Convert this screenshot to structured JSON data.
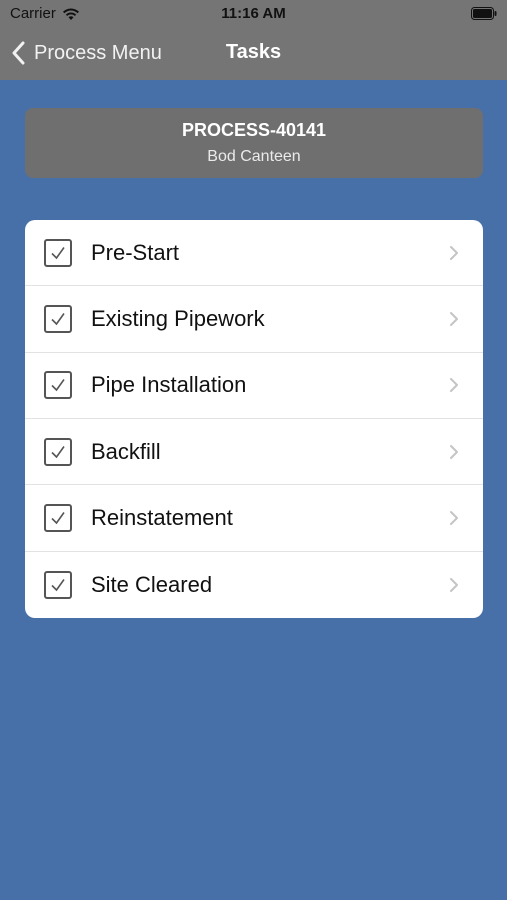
{
  "status_bar": {
    "carrier": "Carrier",
    "time": "11:16 AM"
  },
  "nav": {
    "back_label": "Process Menu",
    "title": "Tasks"
  },
  "process": {
    "id": "PROCESS-40141",
    "name": "Bod Canteen"
  },
  "tasks": [
    {
      "label": "Pre-Start",
      "checked": true
    },
    {
      "label": "Existing Pipework",
      "checked": true
    },
    {
      "label": "Pipe Installation",
      "checked": true
    },
    {
      "label": "Backfill",
      "checked": true
    },
    {
      "label": "Reinstatement",
      "checked": true
    },
    {
      "label": "Site Cleared",
      "checked": true
    }
  ],
  "colors": {
    "background": "#4870a8",
    "nav_bar": "#757575",
    "header_card": "#6f6f6f",
    "list_background": "#ffffff"
  }
}
